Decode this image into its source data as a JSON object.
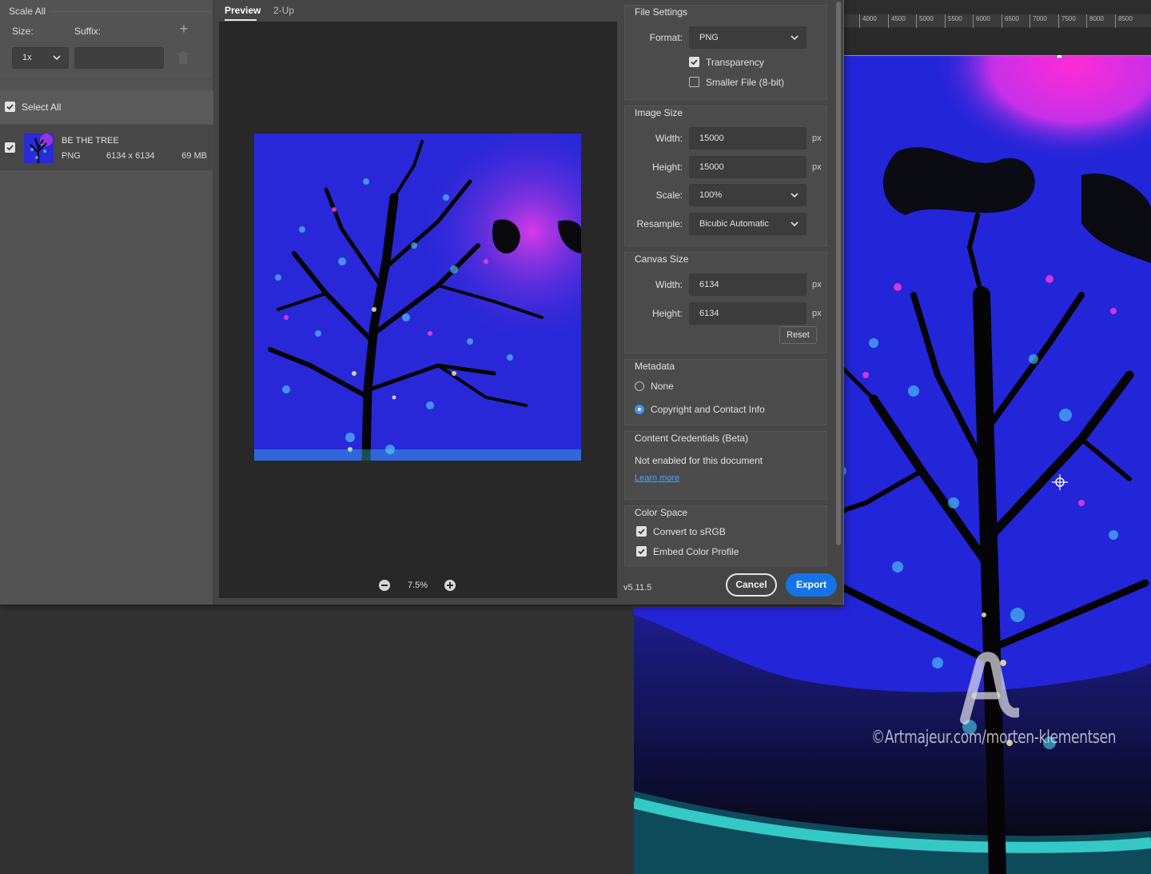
{
  "ruler": {
    "ticks": [
      "4000",
      "4500",
      "5000",
      "5500",
      "6000",
      "6500",
      "7000",
      "7500",
      "8000",
      "8500"
    ]
  },
  "watermark": {
    "text": "©Artmajeur.com/morten-klementsen"
  },
  "left_panel": {
    "title": "Scale All",
    "size_label": "Size:",
    "suffix_label": "Suffix:",
    "add_icon": "plus-icon",
    "size_value": "1x",
    "suffix_value": "",
    "trash_icon": "trash-icon",
    "select_all_label": "Select All",
    "select_all_checked": true,
    "asset": {
      "name": "BE THE TREE",
      "format": "PNG",
      "dimensions": "6134 x 6134",
      "file_size": "69 MB",
      "checked": true
    }
  },
  "preview": {
    "tabs": [
      {
        "label": "Preview",
        "active": true
      },
      {
        "label": "2-Up",
        "active": false
      }
    ],
    "zoom": "7.5%"
  },
  "settings": {
    "file_settings": {
      "title": "File Settings",
      "format_label": "Format:",
      "format_value": "PNG",
      "transparency_label": "Transparency",
      "transparency_checked": true,
      "smaller_file_label": "Smaller File (8-bit)",
      "smaller_file_checked": false
    },
    "image_size": {
      "title": "Image Size",
      "width_label": "Width:",
      "width_value": "15000",
      "height_label": "Height:",
      "height_value": "15000",
      "unit": "px",
      "scale_label": "Scale:",
      "scale_value": "100%",
      "resample_label": "Resample:",
      "resample_value": "Bicubic Automatic"
    },
    "canvas_size": {
      "title": "Canvas Size",
      "width_label": "Width:",
      "width_value": "6134",
      "height_label": "Height:",
      "height_value": "6134",
      "unit": "px",
      "reset_label": "Reset"
    },
    "metadata": {
      "title": "Metadata",
      "option_none": "None",
      "option_copyright": "Copyright and Contact Info",
      "selected": "Copyright and Contact Info"
    },
    "content_credentials": {
      "title": "Content Credentials (Beta)",
      "status": "Not enabled for this document",
      "link": "Learn more"
    },
    "color_space": {
      "title": "Color Space",
      "convert_label": "Convert to sRGB",
      "convert_checked": true,
      "embed_label": "Embed Color Profile",
      "embed_checked": true
    }
  },
  "footer": {
    "version": "v5.11.5",
    "cancel_label": "Cancel",
    "export_label": "Export"
  },
  "colors": {
    "accent": "#1473e6",
    "link": "#4aa0ff",
    "panel": "#454545"
  }
}
